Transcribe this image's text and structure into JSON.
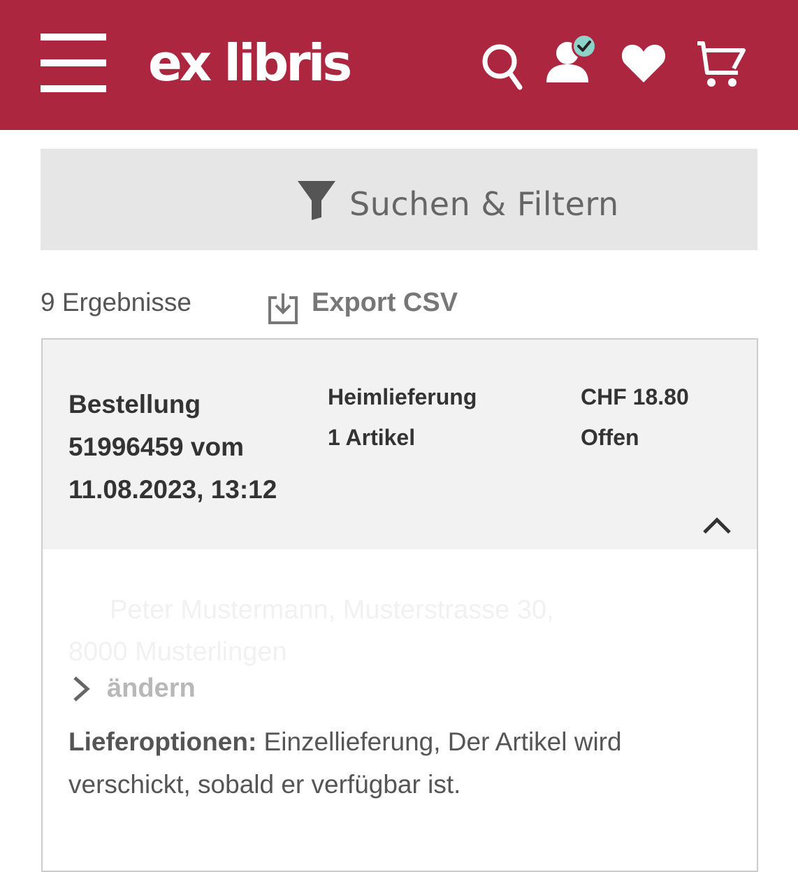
{
  "header": {
    "logo": "ex libris",
    "brand_color": "#ac2640",
    "icons": [
      "menu-icon",
      "search-icon",
      "account-icon",
      "verified-check-icon",
      "heart-icon",
      "cart-icon"
    ]
  },
  "filter": {
    "label": "Suchen & Filtern",
    "icon": "funnel-icon"
  },
  "results": {
    "count_label": "9 Ergebnisse",
    "export_label": "Export CSV",
    "export_icon": "download-icon"
  },
  "order": {
    "title_line1": "Bestellung",
    "title_line2": "51996459 vom",
    "title_line3": "11.08.2023, 13:12",
    "delivery_type": "Heimlieferung",
    "items": "1 Artikel",
    "price": "CHF 18.80",
    "status": "Offen",
    "address_line1": "Peter Mustermann, Musterstrasse 30,",
    "address_line2": "8000 Musterlingen",
    "change_label": "ändern",
    "options_label": "Lieferoptionen:",
    "options_text": " Einzellieferung, Der Artikel wird verschickt, sobald er verfügbar ist."
  }
}
